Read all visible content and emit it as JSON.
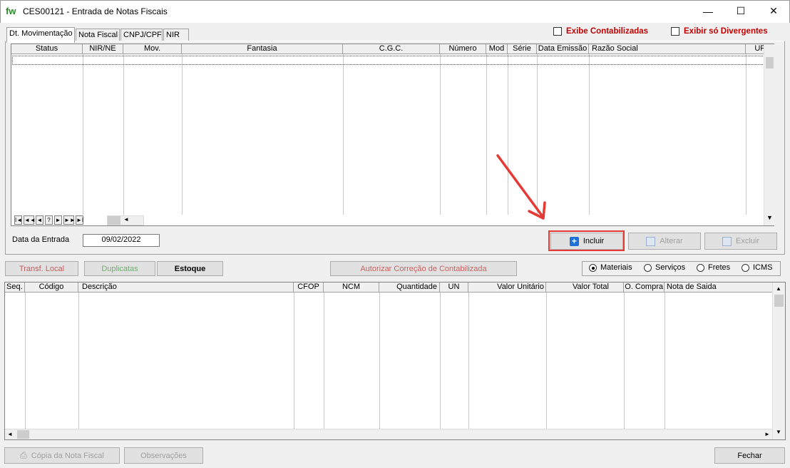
{
  "window": {
    "logo": "fw",
    "title": "CES00121 - Entrada de Notas Fiscais",
    "minimize_glyph": "—",
    "maximize_glyph": "☐",
    "close_glyph": "✕"
  },
  "tabs": [
    "Dt. Movimentação",
    "Nota Fiscal",
    "CNPJ/CPF",
    "NIR"
  ],
  "filters": {
    "exibe_contabilizadas": "Exibe Contabilizadas",
    "exibir_divergentes": "Exibir só Divergentes"
  },
  "top_grid": {
    "columns": [
      "Status",
      "NIR/NE",
      "Mov.",
      "Fantasia",
      "C.G.C.",
      "Número",
      "Mod",
      "Série",
      "Data Emissão",
      "Razão Social",
      "UF"
    ],
    "nav_buttons": [
      "I◄",
      "◄◄",
      "◄",
      "?",
      "►",
      "►►",
      "►I"
    ]
  },
  "entry": {
    "label": "Data da Entrada",
    "value": "09/02/2022"
  },
  "actions": {
    "incluir": "Incluir",
    "alterar": "Alterar",
    "excluir": "Excluir"
  },
  "middle_buttons": {
    "transf_local": "Transf. Local",
    "duplicatas": "Duplicatas",
    "estoque": "Estoque",
    "autorizar": "Autorizar Correção de Contabilizada"
  },
  "item_type": {
    "options": [
      "Materiais",
      "Serviços",
      "Fretes",
      "ICMS"
    ],
    "selected": "Materiais"
  },
  "bottom_grid": {
    "columns": [
      "Seq.",
      "Código",
      "Descrição",
      "CFOP",
      "NCM",
      "Quantidade",
      "UN",
      "Valor Unitário",
      "Valor Total",
      "O. Compra",
      "Nota  de Saida"
    ]
  },
  "footer": {
    "copia": "Cópia da Nota Fiscal",
    "observacoes": "Observações",
    "fechar": "Fechar"
  },
  "colors": {
    "filter_label": "#c00000",
    "highlight_box": "#e53935",
    "arrow": "#e53935",
    "incluir_icon": "#1e6fd6",
    "duplicatas_disabled": "#70b070",
    "transf_disabled": "#c06060",
    "autorizar_disabled": "#d06060"
  }
}
